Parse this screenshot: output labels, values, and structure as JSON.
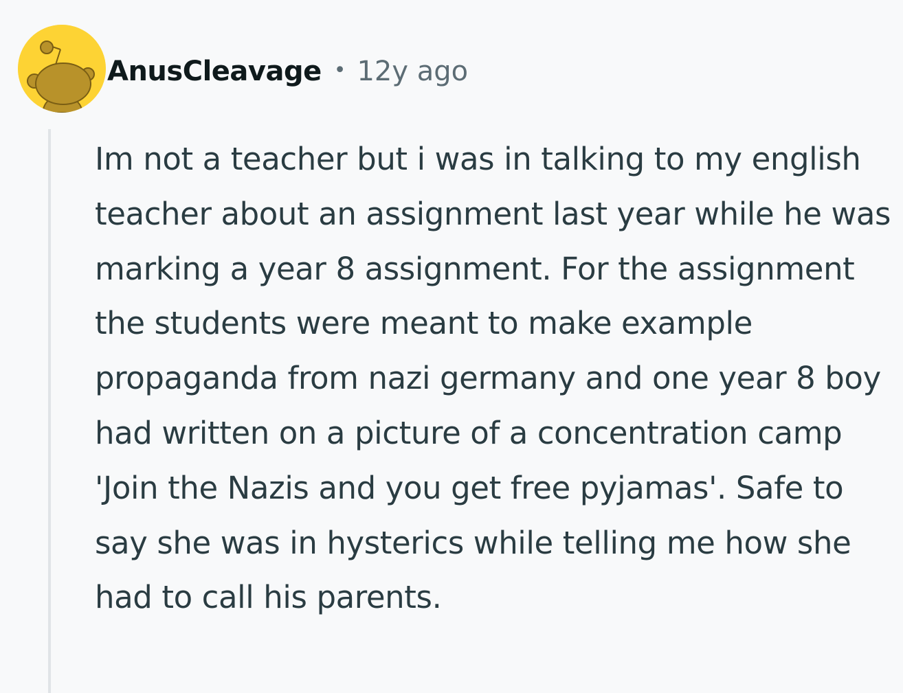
{
  "comment": {
    "author": "AnusCleavage",
    "separator": "•",
    "timestamp": "12y ago",
    "avatar_icon": "snoo-avatar-icon",
    "avatar_color": "#fdd334",
    "body": "Im not a teacher but i was in talking to my english teacher about an assignment last year while he was marking a year 8 assignment. For the assignment the students were meant to make example propaganda from nazi germany and one year 8 boy had written on a picture of a concentration camp 'Join the Nazis and you get free pyjamas'. Safe to say she was in hysterics while telling me how she had to call his parents."
  }
}
